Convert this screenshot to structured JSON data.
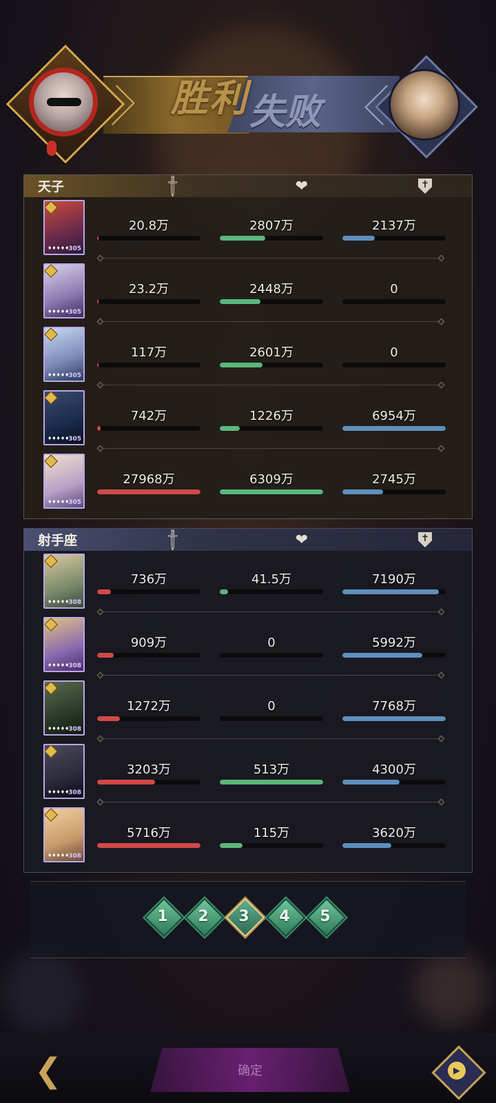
{
  "header": {
    "win_label": "胜利",
    "lose_label": "失败"
  },
  "teams": [
    {
      "name": "天子",
      "theme": "gold",
      "rows": [
        {
          "attack": "20.8万",
          "attack_pct": 0.01,
          "heal": "2807万",
          "heal_pct": 0.44,
          "defense": "2137万",
          "defense_pct": 0.31,
          "card_level": "305"
        },
        {
          "attack": "23.2万",
          "attack_pct": 0.01,
          "heal": "2448万",
          "heal_pct": 0.39,
          "defense": "0",
          "defense_pct": 0,
          "card_level": "305"
        },
        {
          "attack": "117万",
          "attack_pct": 0.01,
          "heal": "2601万",
          "heal_pct": 0.41,
          "defense": "0",
          "defense_pct": 0,
          "card_level": "305"
        },
        {
          "attack": "742万",
          "attack_pct": 0.03,
          "heal": "1226万",
          "heal_pct": 0.19,
          "defense": "6954万",
          "defense_pct": 1.0,
          "card_level": "305"
        },
        {
          "attack": "27968万",
          "attack_pct": 1.0,
          "heal": "6309万",
          "heal_pct": 1.0,
          "defense": "2745万",
          "defense_pct": 0.39,
          "card_level": "305"
        }
      ]
    },
    {
      "name": "射手座",
      "theme": "blue",
      "rows": [
        {
          "attack": "736万",
          "attack_pct": 0.13,
          "heal": "41.5万",
          "heal_pct": 0.08,
          "defense": "7190万",
          "defense_pct": 0.93,
          "card_level": "308"
        },
        {
          "attack": "909万",
          "attack_pct": 0.16,
          "heal": "0",
          "heal_pct": 0,
          "defense": "5992万",
          "defense_pct": 0.77,
          "card_level": "308"
        },
        {
          "attack": "1272万",
          "attack_pct": 0.22,
          "heal": "0",
          "heal_pct": 0,
          "defense": "7768万",
          "defense_pct": 1.0,
          "card_level": "308"
        },
        {
          "attack": "3203万",
          "attack_pct": 0.56,
          "heal": "513万",
          "heal_pct": 1.0,
          "defense": "4300万",
          "defense_pct": 0.55,
          "card_level": "308"
        },
        {
          "attack": "5716万",
          "attack_pct": 1.0,
          "heal": "115万",
          "heal_pct": 0.22,
          "defense": "3620万",
          "defense_pct": 0.47,
          "card_level": "308"
        }
      ]
    }
  ],
  "rounds": {
    "items": [
      "1",
      "2",
      "3",
      "4",
      "5"
    ],
    "active_index": 2
  },
  "icons": {
    "attack": "sword-icon",
    "heal": "heart-icon",
    "defense": "shield-icon",
    "back": "back-arrow-icon",
    "replay": "replay-icon"
  },
  "colors": {
    "attack": "#d04a48",
    "heal": "#5ab87a",
    "defense": "#5e8fbc",
    "win": "#b8924c",
    "lose": "#8f97b6"
  },
  "bottom": {
    "center_label": "确定"
  }
}
